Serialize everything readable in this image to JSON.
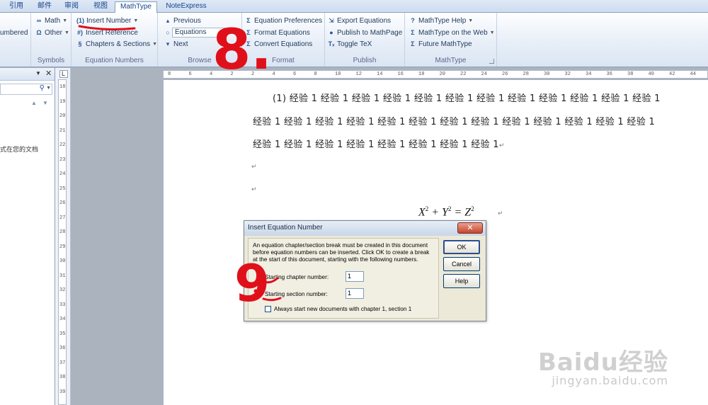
{
  "tabs": [
    {
      "label": "引用",
      "active": false
    },
    {
      "label": "邮件",
      "active": false
    },
    {
      "label": "审阅",
      "active": false
    },
    {
      "label": "视图",
      "active": false
    },
    {
      "label": "MathType",
      "active": true
    },
    {
      "label": "NoteExpress",
      "active": false
    }
  ],
  "ribbon": {
    "partial_left": "umbered",
    "symbols": {
      "label": "Symbols",
      "math": "Math",
      "other": "Other"
    },
    "equation_numbers": {
      "label": "Equation Numbers",
      "insert_number": "Insert Number",
      "insert_number_icon": "(1)",
      "insert_reference": "Insert Reference",
      "chapters_sections": "Chapters & Sections"
    },
    "browse": {
      "label": "Browse",
      "previous": "Previous",
      "combo_value": "Equations",
      "next": "Next"
    },
    "format": {
      "label": "Format",
      "equation_preferences": "Equation Preferences",
      "format_equations": "Format Equations",
      "convert_equations": "Convert Equations"
    },
    "publish": {
      "label": "Publish",
      "export_equations": "Export Equations",
      "publish_mathpage": "Publish to MathPage",
      "toggle_tex": "Toggle TeX"
    },
    "mathtype": {
      "label": "MathType",
      "help": "MathType Help",
      "on_web": "MathType on the Web",
      "future": "Future MathType"
    }
  },
  "navpane": {
    "text": "式在您的文档"
  },
  "ruler": {
    "h_ticks": [
      "8",
      "6",
      "4",
      "2",
      "2",
      "4",
      "6",
      "8",
      "10",
      "12",
      "14",
      "16",
      "18",
      "20",
      "22",
      "24",
      "26",
      "28",
      "30",
      "32",
      "34",
      "36",
      "38",
      "40",
      "42",
      "44"
    ],
    "v_ticks": [
      "18",
      "19",
      "20",
      "21",
      "22",
      "23",
      "24",
      "25",
      "26",
      "27",
      "28",
      "29",
      "30",
      "31",
      "32",
      "33",
      "34",
      "35",
      "36",
      "37",
      "38",
      "39"
    ]
  },
  "document": {
    "line1": "(1)   经验 1 经验 1 经验 1 经验 1 经验 1 经验 1 经验 1 经验 1 经验 1 经验 1 经验 1 经验 1",
    "line2": "经验 1 经验 1 经验 1 经验 1 经验 1 经验 1 经验 1 经验 1 经验 1 经验 1 经验 1 经验 1 经验 1",
    "line3": "经验 1 经验 1 经验 1 经验 1 经验 1 经验 1 经验 1 经验 1",
    "para_mark": "↵"
  },
  "dialog": {
    "title": "Insert Equation Number",
    "message": "An equation chapter/section break must be created in this document before equation numbers can be inserted. Click OK to create a break at the start of this document, starting with the following numbers.",
    "chapter_label": "Starting chapter number:",
    "chapter_value": "1",
    "section_label": "Starting section number:",
    "section_value": "1",
    "checkbox_label": "Always start new documents with chapter 1, section 1",
    "checkbox_checked": false,
    "ok": "OK",
    "cancel": "Cancel",
    "help": "Help"
  },
  "annotations": {
    "step8": "8.",
    "step9": "9"
  },
  "watermark": {
    "brand": "Baidu经验",
    "url": "jingyan.baidu.com"
  },
  "colors": {
    "annotation_red": "#e0101a",
    "ribbon_text": "#1e395b"
  }
}
